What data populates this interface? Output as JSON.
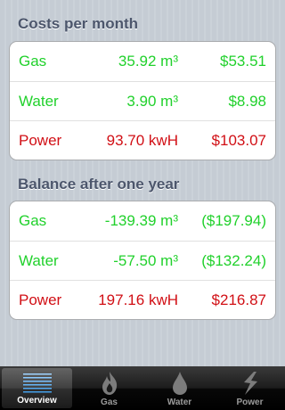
{
  "costs": {
    "title": "Costs per month",
    "rows": [
      {
        "label": "Gas",
        "qty": "35.92 m³",
        "amount": "$53.51"
      },
      {
        "label": "Water",
        "qty": "3.90 m³",
        "amount": "$8.98"
      },
      {
        "label": "Power",
        "qty": "93.70 kwH",
        "amount": "$103.07"
      }
    ]
  },
  "balance": {
    "title": "Balance after one year",
    "rows": [
      {
        "label": "Gas",
        "qty": "-139.39 m³",
        "amount": "($197.94)"
      },
      {
        "label": "Water",
        "qty": "-57.50 m³",
        "amount": "($132.24)"
      },
      {
        "label": "Power",
        "qty": "197.16 kwH",
        "amount": "$216.87"
      }
    ]
  },
  "colors": {
    "positive": "#21d12c",
    "negative": "#d10f15"
  },
  "tabbar": {
    "tabs": [
      {
        "label": "Overview",
        "icon": "overview-lines-icon",
        "selected": true
      },
      {
        "label": "Gas",
        "icon": "flame-icon",
        "selected": false
      },
      {
        "label": "Water",
        "icon": "water-drop-icon",
        "selected": false
      },
      {
        "label": "Power",
        "icon": "lightning-icon",
        "selected": false
      }
    ]
  }
}
